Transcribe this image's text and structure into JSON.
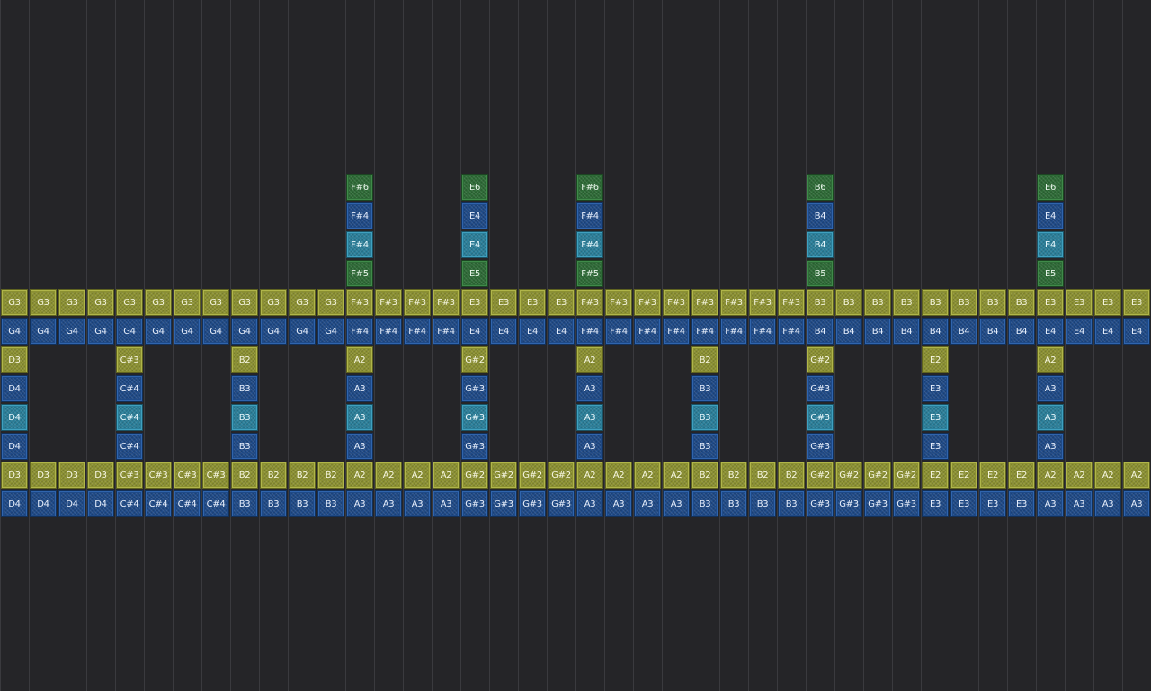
{
  "grid": {
    "columns": 40,
    "colors": {
      "olive": "#8c9132",
      "blue": "#1f4a87",
      "teal": "#2b7f9a",
      "green": "#2e6b37",
      "background": "#252528",
      "gridline": "#3a3a3e"
    }
  },
  "rows": {
    "upper_olive": [
      "G3",
      "G3",
      "G3",
      "G3",
      "G3",
      "G3",
      "G3",
      "G3",
      "G3",
      "G3",
      "G3",
      "G3",
      "F#3",
      "F#3",
      "F#3",
      "F#3",
      "E3",
      "E3",
      "E3",
      "E3",
      "F#3",
      "F#3",
      "F#3",
      "F#3",
      "F#3",
      "F#3",
      "F#3",
      "F#3",
      "B3",
      "B3",
      "B3",
      "B3",
      "B3",
      "B3",
      "B3",
      "B3",
      "E3",
      "E3",
      "E3",
      "E3"
    ],
    "upper_blue": [
      "G4",
      "G4",
      "G4",
      "G4",
      "G4",
      "G4",
      "G4",
      "G4",
      "G4",
      "G4",
      "G4",
      "G4",
      "F#4",
      "F#4",
      "F#4",
      "F#4",
      "E4",
      "E4",
      "E4",
      "E4",
      "F#4",
      "F#4",
      "F#4",
      "F#4",
      "F#4",
      "F#4",
      "F#4",
      "F#4",
      "B4",
      "B4",
      "B4",
      "B4",
      "B4",
      "B4",
      "B4",
      "B4",
      "E4",
      "E4",
      "E4",
      "E4"
    ],
    "lower_olive": [
      "D3",
      "D3",
      "D3",
      "D3",
      "C#3",
      "C#3",
      "C#3",
      "C#3",
      "B2",
      "B2",
      "B2",
      "B2",
      "A2",
      "A2",
      "A2",
      "A2",
      "G#2",
      "G#2",
      "G#2",
      "G#2",
      "A2",
      "A2",
      "A2",
      "A2",
      "B2",
      "B2",
      "B2",
      "B2",
      "G#2",
      "G#2",
      "G#2",
      "G#2",
      "E2",
      "E2",
      "E2",
      "E2",
      "A2",
      "A2",
      "A2",
      "A2"
    ],
    "lower_blue": [
      "D4",
      "D4",
      "D4",
      "D4",
      "C#4",
      "C#4",
      "C#4",
      "C#4",
      "B3",
      "B3",
      "B3",
      "B3",
      "A3",
      "A3",
      "A3",
      "A3",
      "G#3",
      "G#3",
      "G#3",
      "G#3",
      "A3",
      "A3",
      "A3",
      "A3",
      "B3",
      "B3",
      "B3",
      "B3",
      "G#3",
      "G#3",
      "G#3",
      "G#3",
      "E3",
      "E3",
      "E3",
      "E3",
      "A3",
      "A3",
      "A3",
      "A3"
    ]
  },
  "upper_stacks": [
    {
      "col": 12,
      "notes": [
        "F#6",
        "F#4",
        "F#4",
        "F#5"
      ]
    },
    {
      "col": 16,
      "notes": [
        "E6",
        "E4",
        "E4",
        "E5"
      ]
    },
    {
      "col": 20,
      "notes": [
        "F#6",
        "F#4",
        "F#4",
        "F#5"
      ]
    },
    {
      "col": 28,
      "notes": [
        "B6",
        "B4",
        "B4",
        "B5"
      ]
    },
    {
      "col": 36,
      "notes": [
        "E6",
        "E4",
        "E4",
        "E5"
      ]
    }
  ],
  "lower_stacks": [
    {
      "col": 0,
      "notes": [
        "D3",
        "D4",
        "D4",
        "D4"
      ]
    },
    {
      "col": 4,
      "notes": [
        "C#3",
        "C#4",
        "C#4",
        "C#4"
      ]
    },
    {
      "col": 8,
      "notes": [
        "B2",
        "B3",
        "B3",
        "B3"
      ]
    },
    {
      "col": 12,
      "notes": [
        "A2",
        "A3",
        "A3",
        "A3"
      ]
    },
    {
      "col": 16,
      "notes": [
        "G#2",
        "G#3",
        "G#3",
        "G#3"
      ]
    },
    {
      "col": 20,
      "notes": [
        "A2",
        "A3",
        "A3",
        "A3"
      ]
    },
    {
      "col": 24,
      "notes": [
        "B2",
        "B3",
        "B3",
        "B3"
      ]
    },
    {
      "col": 28,
      "notes": [
        "G#2",
        "G#3",
        "G#3",
        "G#3"
      ]
    },
    {
      "col": 32,
      "notes": [
        "E2",
        "E3",
        "E3",
        "E3"
      ]
    },
    {
      "col": 36,
      "notes": [
        "A2",
        "A3",
        "A3",
        "A3"
      ]
    }
  ]
}
